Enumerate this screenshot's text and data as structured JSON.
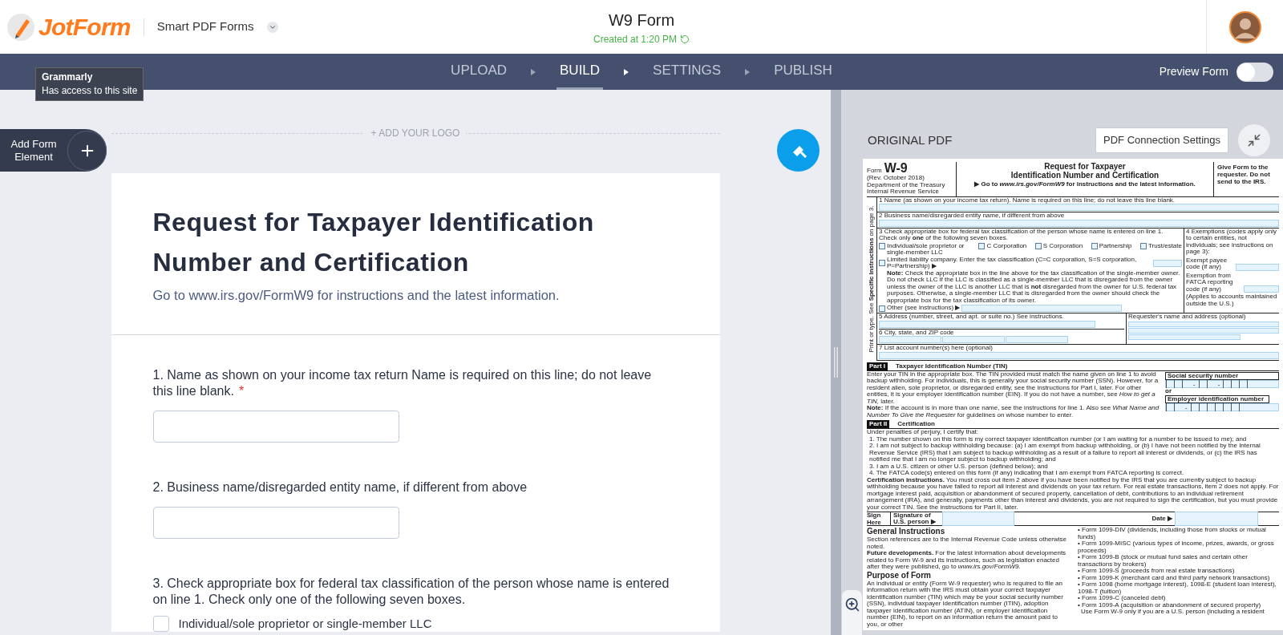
{
  "header": {
    "logo_text": "JotForm",
    "product": "Smart PDF Forms",
    "form_title": "W9 Form",
    "status": "Created at 1:20 PM"
  },
  "tooltip": {
    "lines": [
      "Grammarly",
      "Has access to this site"
    ]
  },
  "steps": [
    {
      "label": "UPLOAD",
      "selected": false
    },
    {
      "label": "BUILD",
      "selected": true
    },
    {
      "label": "SETTINGS",
      "selected": false
    },
    {
      "label": "PUBLISH",
      "selected": false
    }
  ],
  "preview": {
    "label": "Preview Form",
    "on": false
  },
  "builder": {
    "add_element": "Add Form Element",
    "required_mark": "*",
    "logo_placeholder": "+ ADD YOUR LOGO",
    "title": "Request for Taxpayer Identification Number and Certification",
    "subtitle": "Go to www.irs.gov/FormW9 for instructions and the latest information.",
    "questions": [
      {
        "kind": "text",
        "label": "1. Name as shown on your income tax return Name is required on this line; do not leave this line blank.",
        "required": true
      },
      {
        "kind": "text",
        "label": "2. Business name/disregarded entity name, if different from above",
        "required": false
      },
      {
        "kind": "choice",
        "label": "3. Check appropriate box for federal tax classification of the person whose name is entered on line 1. Check only one of the following seven boxes.",
        "required": false,
        "options": [
          {
            "label": "Individual/sole proprietor or single-member LLC",
            "checked": false
          }
        ]
      }
    ]
  },
  "pdf_panel": {
    "heading": "ORIGINAL PDF",
    "connection_button": "PDF Connection Settings"
  },
  "pdf": {
    "form_word": "Form",
    "form_number": "W-9",
    "revision": "(Rev. October 2018)",
    "agency": [
      "Department of the Treasury",
      "Internal Revenue Service"
    ],
    "title": [
      "Request for Taxpayer",
      "Identification Number and Certification"
    ],
    "instruction": "▶ Go to *www.irs.gov/FormW9* for instructions and the latest information.",
    "give_form": "Give Form to the requester. Do not send to the IRS.",
    "side_note": "Print or type. See **Specific Instructions** on page 3.",
    "line1": "1  Name (as shown on your income tax return). Name is required on this line; do not leave this line blank.",
    "line2": "2  Business name/disregarded entity name, if different from above",
    "line3": "3  Check appropriate box for federal tax classification of the person whose name is entered on line 1. Check only **one** of the following seven boxes.",
    "classes": [
      {
        "label": "Individual/sole proprietor or single-member LLC",
        "checked": false
      },
      {
        "label": "C Corporation",
        "checked": false
      },
      {
        "label": "S Corporation",
        "checked": false
      },
      {
        "label": "Partnership",
        "checked": false
      },
      {
        "label": "Trust/estate",
        "checked": false
      }
    ],
    "llc": {
      "label": "Limited liability company. Enter the tax classification (C=C corporation, S=S corporation, P=Partnership) ▶",
      "checked": false
    },
    "llc_note": "**Note:** Check the appropriate box in the line above for the tax classification of the single-member owner.  Do not check LLC if the LLC is classified as a single-member LLC that is disregarded from the owner unless the owner of the LLC is another LLC that is **not** disregarded from the owner for U.S. federal tax purposes. Otherwise, a single-member LLC that is disregarded from the owner should check the appropriate box for the tax classification of its owner.",
    "other": {
      "label": "Other (see instructions) ▶",
      "checked": false
    },
    "exemptions": "4  Exemptions (codes apply only to certain entities, not individuals; see instructions on page 3):",
    "exempt_payee": "Exempt payee code (if any)",
    "fatca": "Exemption from FATCA reporting code (if any)",
    "fatca_note": "(Applies to accounts maintained outside the U.S.)",
    "line5": "5  Address (number, street, and apt. or suite no.) See instructions.",
    "requester": "Requester's name and address (optional)",
    "line6": "6  City, state, and ZIP code",
    "line7": "7  List account number(s) here (optional)",
    "part1": {
      "tag": "Part I",
      "title": "Taxpayer Identification Number (TIN)",
      "text": "Enter your TIN in the appropriate box. The TIN provided must match the name given on line 1 to avoid backup withholding. For individuals, this is generally your social security number (SSN). However, for a resident alien, sole proprietor, or disregarded entity, see the instructions for Part I, later. For other entities, it is your employer identification number (EIN). If you do not have a number, see *How to get a TIN,* later.",
      "note": "**Note:** If the account is in more than one name, see the instructions for line 1. Also see *What Name and Number To Give the Requester* for guidelines on whose number to enter.",
      "ssn_label": "Social security number",
      "ssn_separators": [
        "-",
        "-"
      ],
      "or": "or",
      "ein_label": "Employer identification number",
      "ein_separator": "-"
    },
    "part2": {
      "tag": "Part II",
      "title": "Certification",
      "intro": "Under penalties of perjury, I certify that:",
      "items": [
        "1. The number shown on this form is my correct taxpayer identification number (or I am waiting for a number to be issued to me); and",
        "2. I am not subject to backup withholding because: (a) I am exempt from backup withholding, or (b) I have not been notified by the Internal Revenue Service (IRS) that I am subject to backup withholding as a result of a failure to report all interest or dividends, or (c) the IRS has notified me that I am no longer subject to backup withholding; and",
        "3. I am a U.S. citizen or other U.S. person (defined below); and",
        "4. The FATCA code(s) entered on this form (if any) indicating that I am exempt from FATCA reporting is correct."
      ],
      "instructions": "**Certification instructions.** You must cross out item 2 above if you have been notified by the IRS that you are currently subject to backup withholding because you have failed to report all interest and dividends on your tax return. For real estate transactions, item 2 does not apply. For mortgage interest paid, acquisition or abandonment of secured property, cancellation of debt, contributions to an individual retirement arrangement (IRA), and generally, payments other than interest and dividends, you are not required to sign the certification, but you must provide your correct TIN. See the instructions for Part II, later."
    },
    "sign": {
      "label": "Sign Here",
      "signature": "Signature of U.S. person ▶",
      "date": "Date ▶"
    },
    "general": {
      "heading": "General Instructions",
      "paragraphs": [
        "Section references are to the Internal Revenue Code unless otherwise noted.",
        "**Future developments.** For the latest information about developments related to Form W-9 and its instructions, such as legislation enacted after they were published, go to *www.irs.gov/FormW9.*"
      ],
      "purpose_heading": "Purpose of Form",
      "purpose": "An individual or entity (Form W-9 requester) who is required to file an information return with the IRS must obtain your correct taxpayer identification number (TIN) which may be your social security number (SSN), individual taxpayer identification number (ITIN), adoption taxpayer identification number (ATIN), or employer identification number (EIN), to report on an information return the amount paid to you, or other",
      "bullets": [
        "• Form 1099-DIV (dividends, including those from stocks or mutual funds)",
        "• Form 1099-MISC (various types of income, prizes, awards, or gross proceeds)",
        "• Form 1099-B (stock or mutual fund sales and certain other transactions by brokers)",
        "• Form 1099-S (proceeds from real estate transactions)",
        "• Form 1099-K (merchant card and third party network transactions)",
        "• Form 1098 (home mortgage interest), 1098-E (student loan interest), 1098-T (tuition)",
        "• Form 1099-C (canceled debt)",
        "• Form 1099-A (acquisition or abandonment of secured property)"
      ],
      "closing": "Use Form W-9 only if you are a U.S. person (including a resident"
    }
  }
}
